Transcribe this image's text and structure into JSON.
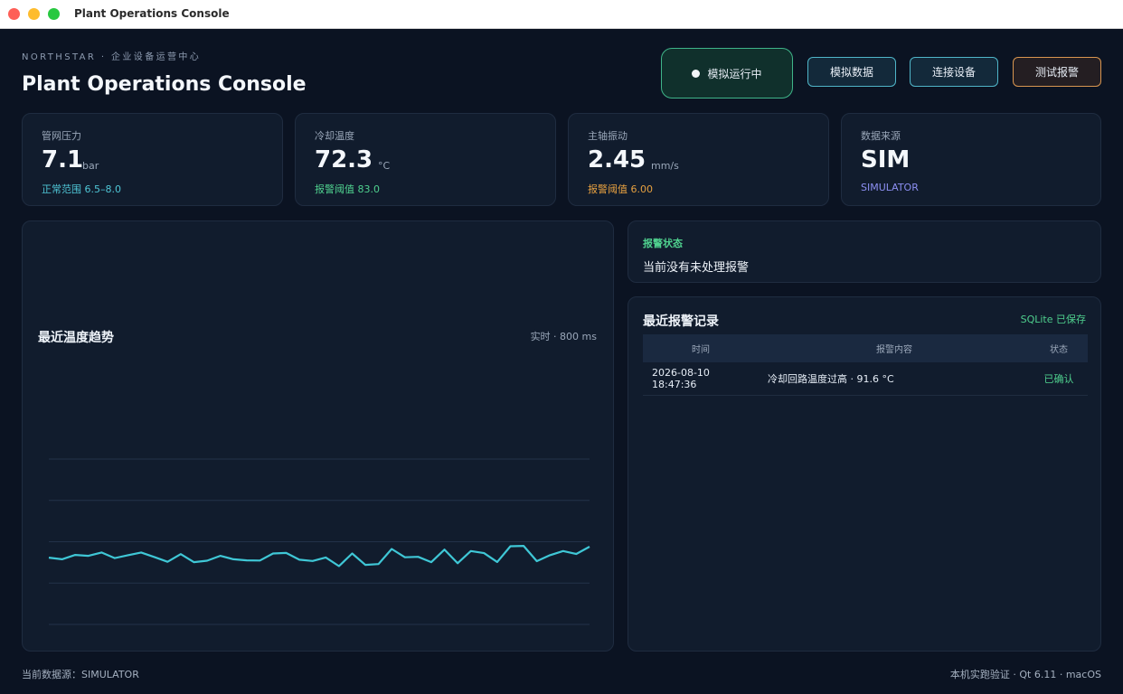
{
  "window": {
    "title": "Plant Operations Console"
  },
  "header": {
    "brand": "NORTHSTAR · 企业设备运营中心",
    "title": "Plant Operations Console",
    "status_label": "模拟运行中",
    "buttons": {
      "simulate": "模拟数据",
      "connect": "连接设备",
      "test_alarm": "测试报警"
    },
    "colors": {
      "status_border": "#3fb489",
      "button_border": "#4fb5c8",
      "alarm_border": "#d89550"
    }
  },
  "metrics": [
    {
      "label": "管网压力",
      "value": "7.1",
      "unit": "bar",
      "note": "正常范围 6.5–8.0",
      "note_color": "#4fc6d6"
    },
    {
      "label": "冷却温度",
      "value": "72.3",
      "unit": "°C",
      "note": "报警阈值 83.0",
      "note_color": "#4fd08e"
    },
    {
      "label": "主轴振动",
      "value": "2.45",
      "unit": "mm/s",
      "note": "报警阈值 6.00",
      "note_color": "#e6a040"
    },
    {
      "label": "数据来源",
      "value": "SIM",
      "unit": "",
      "note": "SIMULATOR",
      "note_color": "#8c8ff2"
    }
  ],
  "chart": {
    "title": "最近温度趋势",
    "meta": "实时 · 800 ms",
    "line_color": "#3fc7d6"
  },
  "chart_data": {
    "type": "line",
    "title": "最近温度趋势",
    "xlabel": "",
    "ylabel": "",
    "grid": true,
    "ylim": [
      40,
      120
    ],
    "series": [
      {
        "values": [
          72.3,
          71.5,
          73.6,
          73.2,
          74.8,
          72.1,
          73.5,
          74.8,
          72.6,
          70.3,
          74.0,
          70.1,
          70.8,
          73.2,
          71.5,
          71.0,
          70.9,
          74.3,
          74.6,
          71.3,
          70.7,
          72.4,
          68.2,
          74.3,
          68.8,
          69.2,
          76.5,
          72.5,
          72.7,
          70.1,
          76.2,
          69.6,
          75.5,
          74.5,
          70.2,
          77.8,
          78.0,
          70.6,
          73.5,
          75.5,
          74.1,
          77.6
        ]
      }
    ]
  },
  "alarm": {
    "label": "报警状态",
    "text": "当前没有未处理报警"
  },
  "log": {
    "title": "最近报警记录",
    "saved": "SQLite 已保存",
    "columns": [
      "时间",
      "报警内容",
      "状态"
    ],
    "rows": [
      {
        "date": "2026-08-10",
        "time": "18:47:36",
        "message": "冷却回路温度过高 · 91.6 °C",
        "state": "已确认"
      }
    ]
  },
  "footer": {
    "left": "当前数据源：SIMULATOR",
    "right": "本机实跑验证 · Qt 6.11 · macOS"
  }
}
